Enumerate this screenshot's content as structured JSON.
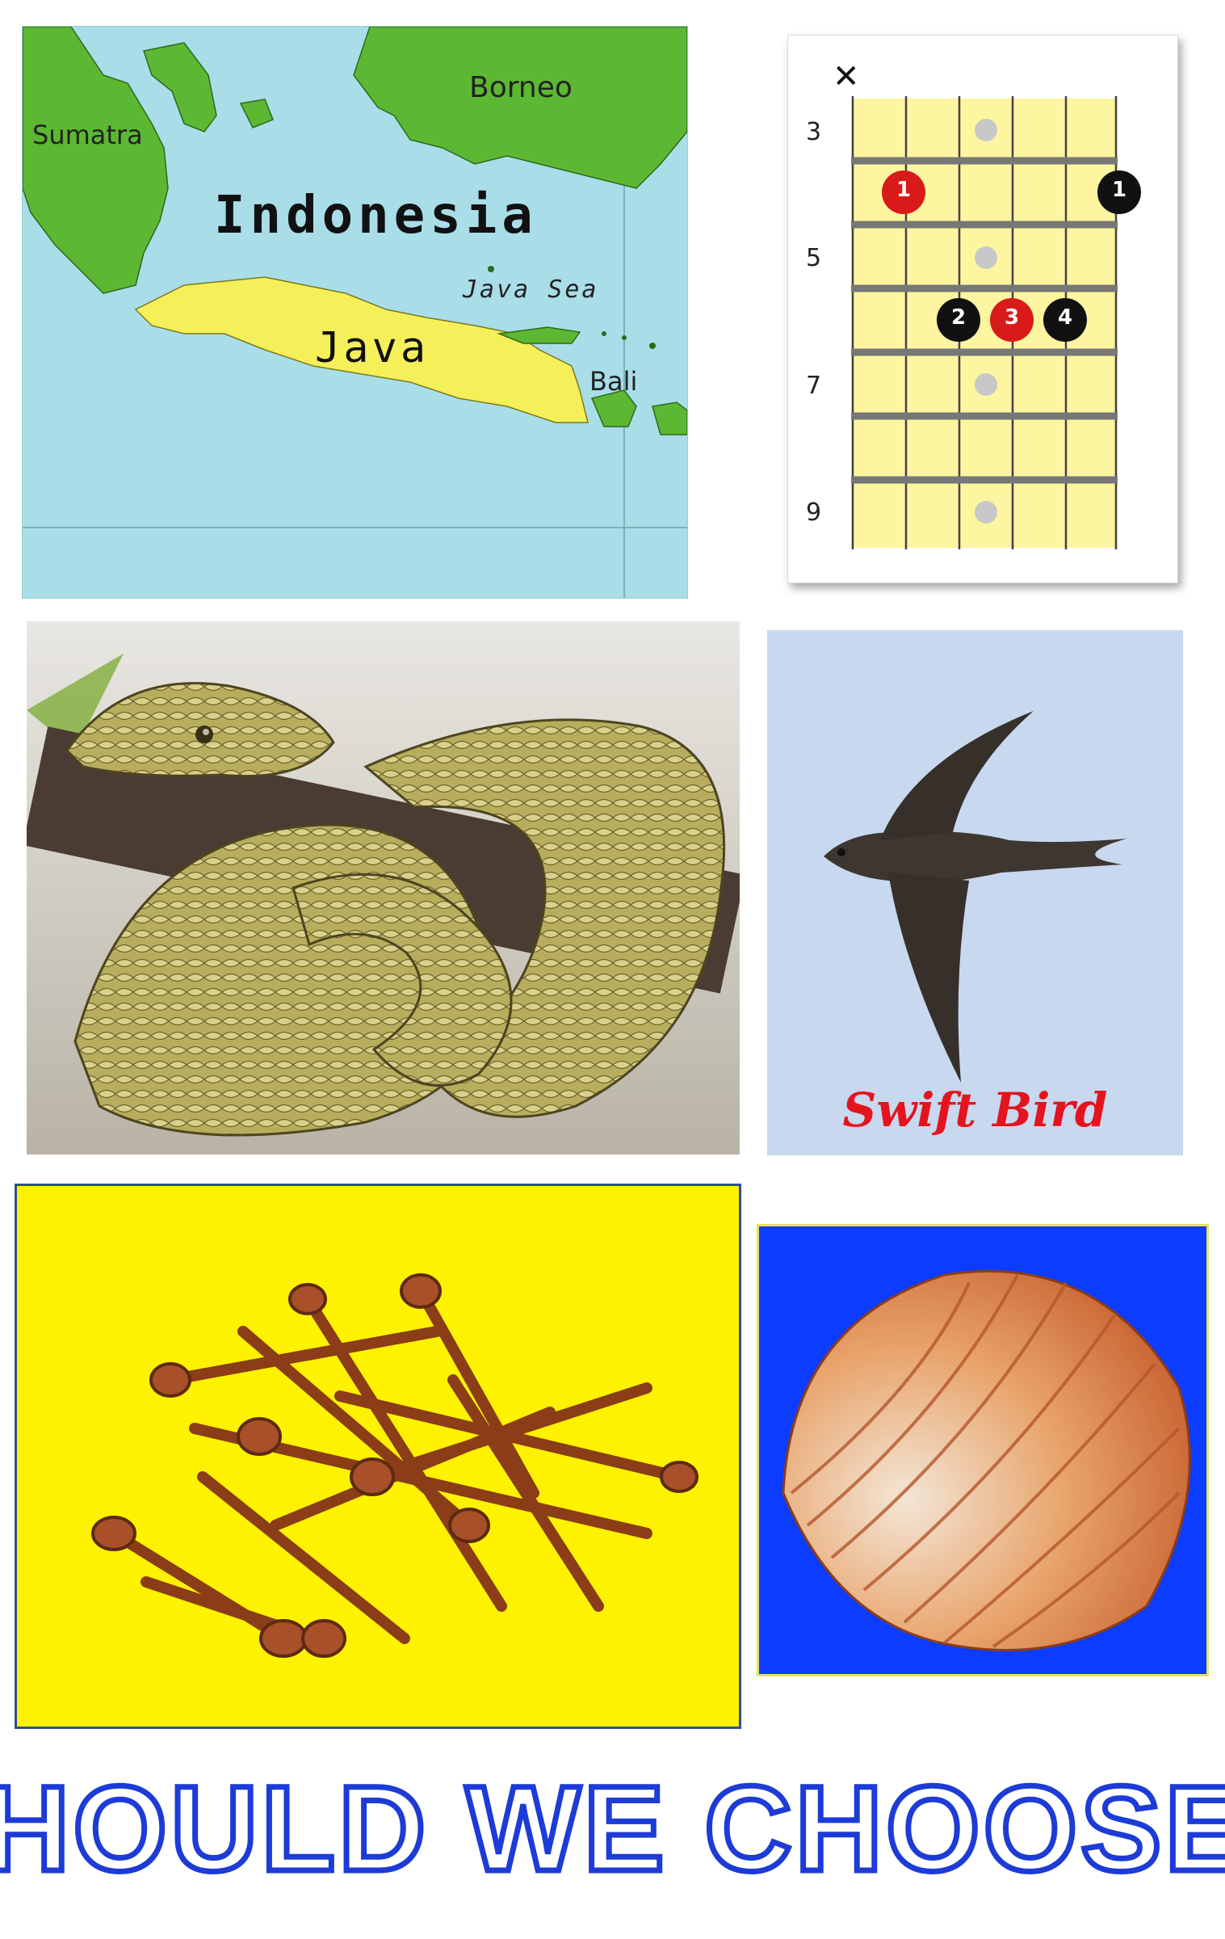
{
  "map": {
    "country_label": "Indonesia",
    "island_labels": [
      "Sumatra",
      "Borneo",
      "Java",
      "Bali"
    ],
    "sea_label": "Java Sea",
    "colors": {
      "sea": "#a9dde8",
      "land": "#5cb832",
      "java": "#f5f05a"
    }
  },
  "fretboard": {
    "muted_symbol": "✕",
    "fret_numbers": [
      "3",
      "5",
      "7",
      "9"
    ],
    "dots": [
      {
        "label": "1",
        "color": "#d91a1a"
      },
      {
        "label": "1",
        "color": "#111111"
      },
      {
        "label": "2",
        "color": "#111111"
      },
      {
        "label": "3",
        "color": "#d91a1a"
      },
      {
        "label": "4",
        "color": "#111111"
      }
    ],
    "colors": {
      "board": "#fdf5a0",
      "fret": "#777777",
      "inlay": "#c8c8c8"
    }
  },
  "python": {
    "subject": "python-snake"
  },
  "swift": {
    "caption": "Swift Bird",
    "caption_color": "#e4141e"
  },
  "nails": {
    "subject": "rusty-nails",
    "background": "#fff200"
  },
  "shell": {
    "subject": "cockle-shell",
    "background": "#0c3cff"
  },
  "headline": {
    "text": "SHOULD WE CHOOSE?",
    "color": "#1d3bd6"
  }
}
